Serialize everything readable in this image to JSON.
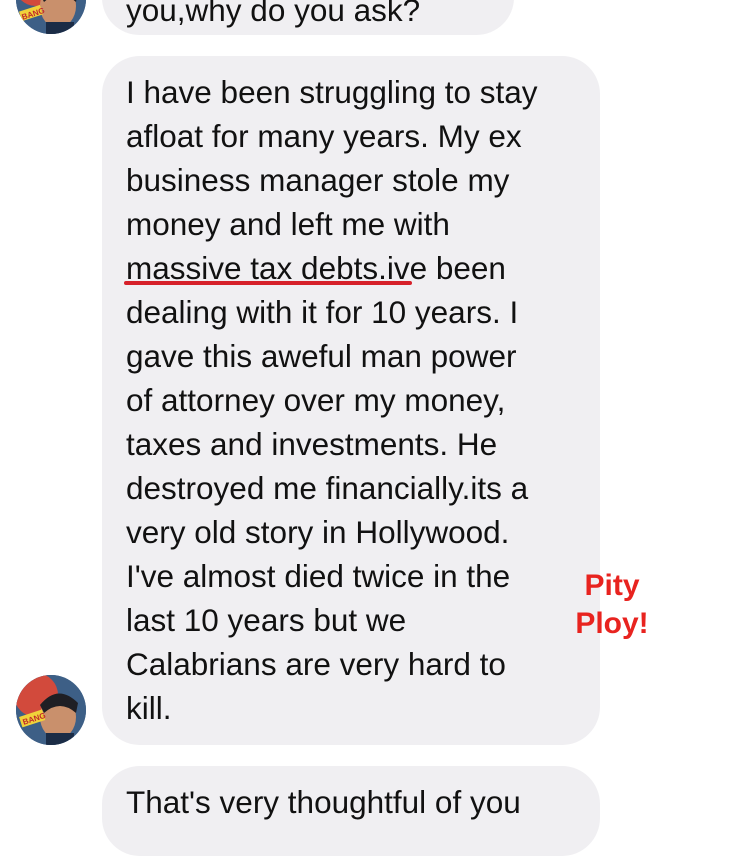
{
  "messages": [
    {
      "visible_text": "you,why do you ask?"
    },
    {
      "lines": [
        "I have been struggling to stay",
        "afloat for many years. My ex",
        "business manager stole my",
        "money and left me with",
        "massive tax debts.",
        "ive been",
        "dealing with it for 10 years. I",
        "gave this aweful man power",
        "of attorney over my money,",
        "taxes and investments. He",
        "destroyed me financially.its a",
        "very old story in Hollywood.",
        "I've almost died twice in the",
        "last 10 years but we",
        "Calabrians are very hard to",
        "kill."
      ]
    },
    {
      "visible_text": "That's very thoughtful of you"
    }
  ],
  "annotation": {
    "line1": "Pity",
    "line2": "Ploy!",
    "color": "#e8231f"
  },
  "avatar": {
    "badge_text": "BANG",
    "icon": "user-avatar-icon"
  },
  "colors": {
    "bubble": "#f0eff2",
    "underline": "#d6202a"
  }
}
